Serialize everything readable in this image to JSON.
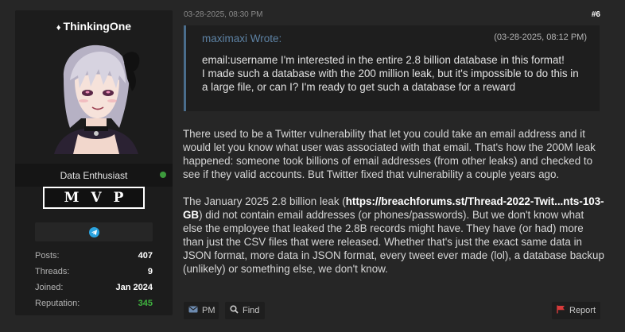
{
  "user": {
    "name": "ThinkingOne",
    "title": "Data Enthusiast",
    "badge": "MVP",
    "online": true,
    "stats": [
      {
        "label": "Posts:",
        "value": "407"
      },
      {
        "label": "Threads:",
        "value": "9"
      },
      {
        "label": "Joined:",
        "value": "Jan 2024"
      },
      {
        "label": "Reputation:",
        "value": "345"
      }
    ],
    "colors": {
      "reputation": "#3fb23f",
      "online": "#3c9a3c",
      "telegram": "#2aa3df"
    }
  },
  "post": {
    "date": "03-28-2025, 08:30 PM",
    "number": "#6",
    "quote": {
      "author": "maximaxi Wrote:",
      "date": "(03-28-2025, 08:12 PM)",
      "lines": [
        "email:username  I'm interested in the entire 2.8 billion database in this format!",
        "I made such a database with the 200 million leak, but it's impossible to do this in a large file, or can I? I'm ready to get such a database for a reward"
      ]
    },
    "paragraph1": "There used to be a Twitter vulnerability that let you could take an email address and it would let you know what user was associated with that email. That's how the 200M leak happened: someone took billions of email addresses (from other leaks) and checked to see if they valid accounts. But Twitter fixed that vulnerability a couple years ago.",
    "paragraph2_pre": "The January 2025 2.8 billion leak (",
    "paragraph2_link": "https://breachforums.st/Thread-2022-Twit...nts-103-GB",
    "paragraph2_post": ") did not contain email addresses (or phones/passwords). But we don't know what else the employee that leaked the 2.8B records might have. They have (or had) more than just the CSV files that were released. Whether that's just the exact same data in JSON format, more data in JSON format, every tweet ever made (lol), a database backup (unlikely) or something else, we don't know."
  },
  "actions": {
    "pm": "PM",
    "find": "Find",
    "report": "Report"
  }
}
